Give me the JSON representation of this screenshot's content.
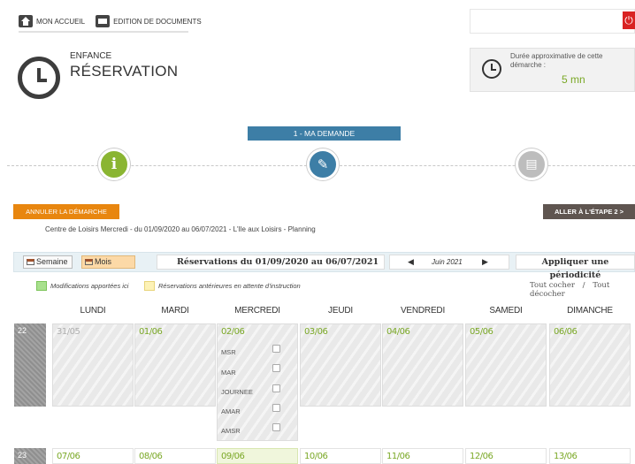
{
  "nav": {
    "home_label": "MON ACCUEIL",
    "docs_label": "EDITION DE DOCUMENTS",
    "power_icon": "power-icon"
  },
  "header": {
    "kicker": "ENFANCE",
    "title": "RÉSERVATION",
    "duration_label": "Durée approximative de cette démarche :",
    "duration_value": "5 mn"
  },
  "stepper": {
    "current_label": "1 - MA DEMANDE",
    "steps": [
      {
        "icon": "info-icon",
        "glyph": "i",
        "color": "#8ab532"
      },
      {
        "icon": "pencil-icon",
        "glyph": "✎",
        "color": "#3d7ea6"
      },
      {
        "icon": "document-icon",
        "glyph": "▤",
        "color": "#bdbdbd"
      }
    ]
  },
  "actions": {
    "cancel_label": "ANNULER LA DÉMARCHE",
    "next_label": "ALLER À L'ÉTAPE 2 >"
  },
  "info_line": "Centre de Loisirs Mercredi - du 01/09/2020 au 06/07/2021 - L'Ile aux Loisirs - Planning",
  "toolbar": {
    "week_label": "Semaine",
    "month_label": "Mois",
    "range_label": "Réservations du 01/09/2020  au  06/07/2021",
    "month_prev": "◀",
    "month_current": "Juin 2021",
    "month_next": "▶",
    "apply_label": "Appliquer une périodicité"
  },
  "legend": {
    "modified_label": "Modifications apportées ici",
    "pending_label": "Réservations antérieures en attente d'instruction",
    "check_all": "Tout cocher",
    "separator": "/",
    "uncheck_all": "Tout décocher"
  },
  "days": [
    "LUNDI",
    "MARDI",
    "MERCREDI",
    "JEUDI",
    "VENDREDI",
    "SAMEDI",
    "DIMANCHE"
  ],
  "weeks": [
    {
      "number": "22",
      "dates": [
        "31/05",
        "01/06",
        "02/06",
        "03/06",
        "04/06",
        "05/06",
        "06/06"
      ],
      "activities": [
        "MSR",
        "MAR",
        "JOURNEE",
        "AMAR",
        "AMSR"
      ]
    },
    {
      "number": "23",
      "dates": [
        "07/06",
        "08/06",
        "09/06",
        "10/06",
        "11/06",
        "12/06",
        "13/06"
      ]
    }
  ]
}
